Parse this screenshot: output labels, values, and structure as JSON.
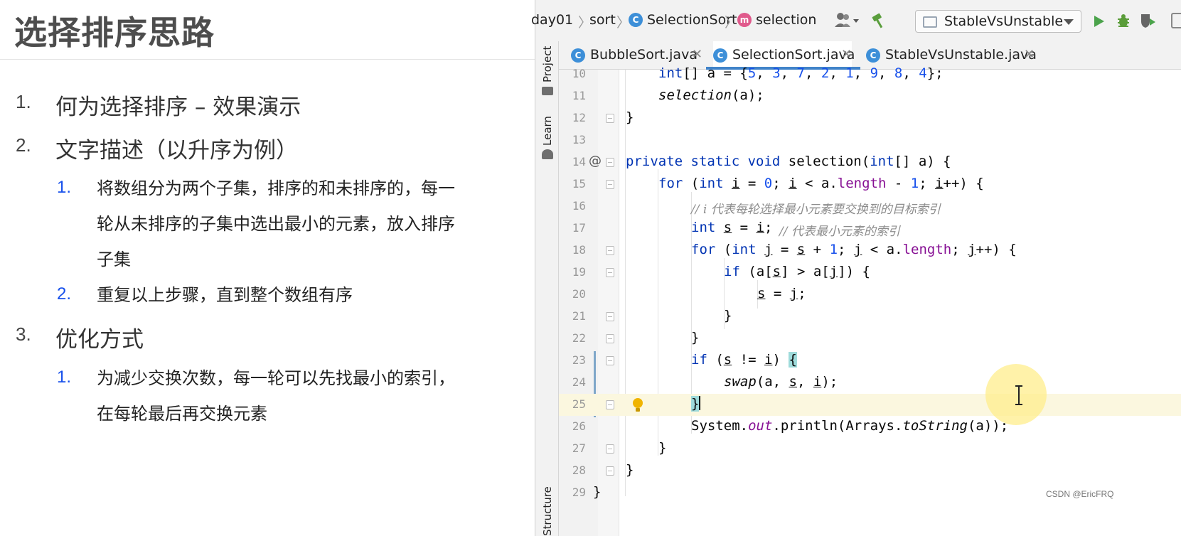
{
  "slide": {
    "title": "选择排序思路",
    "items": [
      {
        "num": "1.",
        "text": "何为选择排序 – 效果演示"
      },
      {
        "num": "2.",
        "text": "文字描述（以升序为例）",
        "sub": [
          {
            "num": "1.",
            "lines": [
              "将数组分为两个子集，排序的和未排序的，每一",
              "轮从未排序的子集中选出最小的元素，放入排序",
              "子集"
            ]
          },
          {
            "num": "2.",
            "lines": [
              "重复以上步骤，直到整个数组有序"
            ]
          }
        ]
      },
      {
        "num": "3.",
        "text": "优化方式",
        "sub": [
          {
            "num": "1.",
            "lines": [
              "为减少交换次数，每一轮可以先找最小的索引，",
              "在每轮最后再交换元素"
            ]
          }
        ]
      }
    ]
  },
  "ide": {
    "breadcrumb": [
      "day01",
      "sort",
      "SelectionSort",
      "selection"
    ],
    "run_config": "StableVsUnstable",
    "tabs": [
      {
        "label": "BubbleSort.java",
        "active": false
      },
      {
        "label": "SelectionSort.java",
        "active": true
      },
      {
        "label": "StableVsUnstable.java",
        "active": false
      }
    ],
    "tool_windows": [
      "Project",
      "Learn",
      "Structure"
    ],
    "line_numbers": [
      "10",
      "11",
      "12",
      "13",
      "14",
      "15",
      "16",
      "17",
      "18",
      "19",
      "20",
      "21",
      "22",
      "23",
      "24",
      "25",
      "26",
      "27",
      "28",
      "29"
    ],
    "code": {
      "l10": "int[] a = {5, 3, 7, 2, 1, 9, 8, 4};",
      "l11": "selection(a);",
      "l12": "}",
      "l14": "private static void selection(int[] a) {",
      "l15": "for (int i = 0; i < a.length - 1; i++) {",
      "l16": "// i 代表每轮选择最小元素要交换到的目标索引",
      "l17_code": "int s = i;",
      "l17_comment": "// 代表最小元素的索引",
      "l18": "for (int j = s + 1; j < a.length; j++) {",
      "l19": "if (a[s] > a[j]) {",
      "l20": "s = j;",
      "l21": "}",
      "l22": "}",
      "l23": "if (s != i) {",
      "l24": "swap(a, s, i);",
      "l25": "}",
      "l26": "System.out.println(Arrays.toString(a));",
      "l27": "}",
      "l28": "}",
      "l29": "}"
    },
    "override_marker": "@",
    "current_line": "25"
  },
  "watermark": "CSDN @EricFRQ",
  "colors": {
    "keyword": "#0033b3",
    "number": "#1750eb",
    "field": "#871094",
    "comment": "#8c8c8c",
    "accent": "#4083c9"
  }
}
